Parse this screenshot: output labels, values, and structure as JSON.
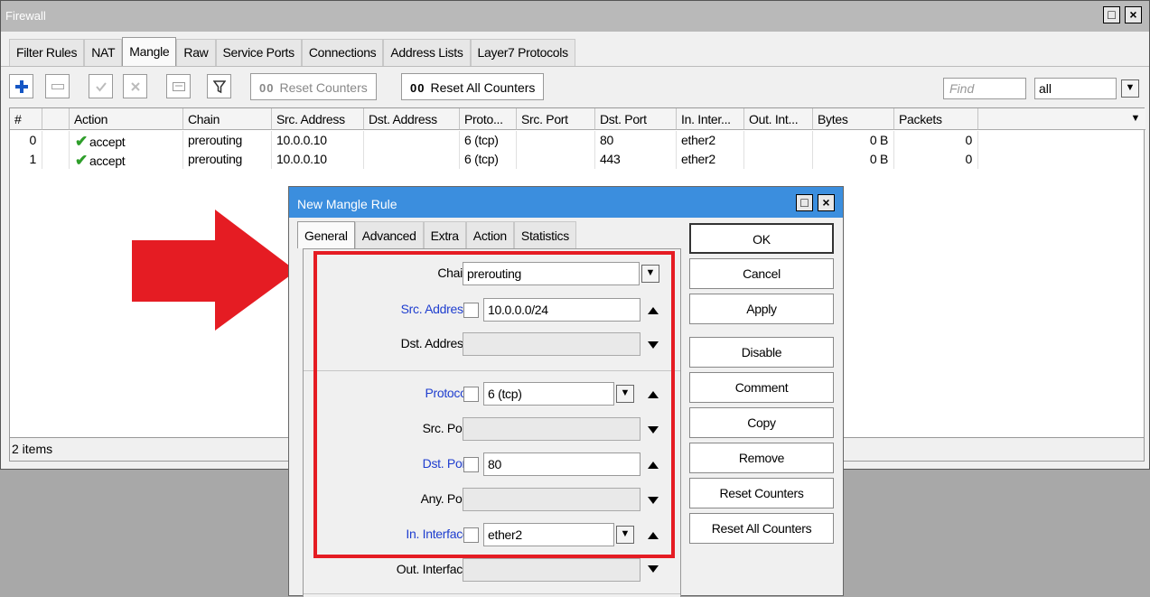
{
  "window": {
    "title": "Firewall",
    "restore_glyph": "□",
    "close_glyph": "×"
  },
  "tabs": [
    "Filter Rules",
    "NAT",
    "Mangle",
    "Raw",
    "Service Ports",
    "Connections",
    "Address Lists",
    "Layer7 Protocols"
  ],
  "active_tab": "Mangle",
  "toolbar": {
    "reset_counters": "Reset Counters",
    "reset_all_counters": "Reset All Counters",
    "counter_glyph": "00",
    "find_placeholder": "Find",
    "filter_value": "all"
  },
  "table": {
    "columns": [
      "#",
      "",
      "Action",
      "Chain",
      "Src. Address",
      "Dst. Address",
      "Proto...",
      "Src. Port",
      "Dst. Port",
      "In. Inter...",
      "Out. Int...",
      "Bytes",
      "Packets"
    ],
    "rows": [
      {
        "num": "0",
        "action": "accept",
        "chain": "prerouting",
        "src": "10.0.0.10",
        "dst": "",
        "proto": "6 (tcp)",
        "sport": "",
        "dport": "80",
        "in_iface": "ether2",
        "out_iface": "",
        "bytes": "0 B",
        "packets": "0"
      },
      {
        "num": "1",
        "action": "accept",
        "chain": "prerouting",
        "src": "10.0.0.10",
        "dst": "",
        "proto": "6 (tcp)",
        "sport": "",
        "dport": "443",
        "in_iface": "ether2",
        "out_iface": "",
        "bytes": "0 B",
        "packets": "0"
      }
    ]
  },
  "status": {
    "items": "2 items"
  },
  "dialog": {
    "title": "New Mangle Rule",
    "tabs": [
      "General",
      "Advanced",
      "Extra",
      "Action",
      "Statistics"
    ],
    "active_tab": "General",
    "fields": {
      "chain": {
        "label": "Chain:",
        "value": "prerouting"
      },
      "src_address": {
        "label": "Src. Address:",
        "value": "10.0.0.0/24"
      },
      "dst_address": {
        "label": "Dst. Address:",
        "value": ""
      },
      "protocol": {
        "label": "Protocol:",
        "value": "6 (tcp)"
      },
      "src_port": {
        "label": "Src. Port:",
        "value": ""
      },
      "dst_port": {
        "label": "Dst. Port:",
        "value": "80"
      },
      "any_port": {
        "label": "Any. Port:",
        "value": ""
      },
      "in_interface": {
        "label": "In. Interface:",
        "value": "ether2"
      },
      "out_interface": {
        "label": "Out. Interface:",
        "value": ""
      }
    },
    "buttons": [
      "OK",
      "Cancel",
      "Apply",
      "Disable",
      "Comment",
      "Copy",
      "Remove",
      "Reset Counters",
      "Reset All Counters"
    ]
  },
  "colors": {
    "accent_title": "#3b8ede",
    "highlight_red": "#e51c23",
    "label_blue": "#1f3ecf",
    "accept_green": "#2e9e2a"
  }
}
